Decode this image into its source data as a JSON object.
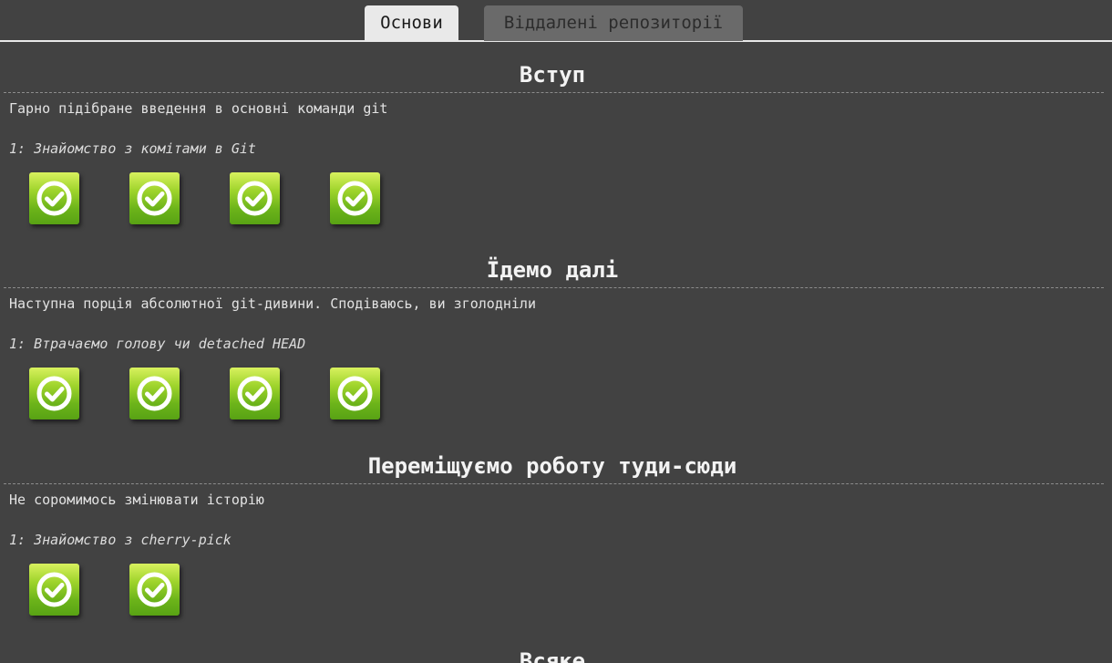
{
  "tabs": [
    {
      "label": "Основи",
      "active": true
    },
    {
      "label": "Віддалені репозиторії",
      "active": false
    }
  ],
  "sections": [
    {
      "title": "Вступ",
      "description": "Гарно підібране введення в основні команди git",
      "level_name": "1: Знайомство з комітами в Git",
      "levels_completed": 4
    },
    {
      "title": "Їдемо далі",
      "description": "Наступна порція абсолютної git-дивини. Сподіваюсь, ви зголодніли",
      "level_name": "1: Втрачаємо голову чи detached HEAD",
      "levels_completed": 4
    },
    {
      "title": "Переміщуємо роботу туди-сюди",
      "description": "Не соромимось змінювати історію",
      "level_name": "1: Знайомство з cherry-pick",
      "levels_completed": 2
    },
    {
      "title": "Всяке"
    }
  ],
  "icons": {
    "level_status": "checkmark-icon"
  },
  "colors": {
    "background": "#424242",
    "level_complete_top": "#d8f15e",
    "level_complete_bottom": "#58a214",
    "active_tab": "#e9e9e9",
    "inactive_tab": "#6a6a6a"
  }
}
